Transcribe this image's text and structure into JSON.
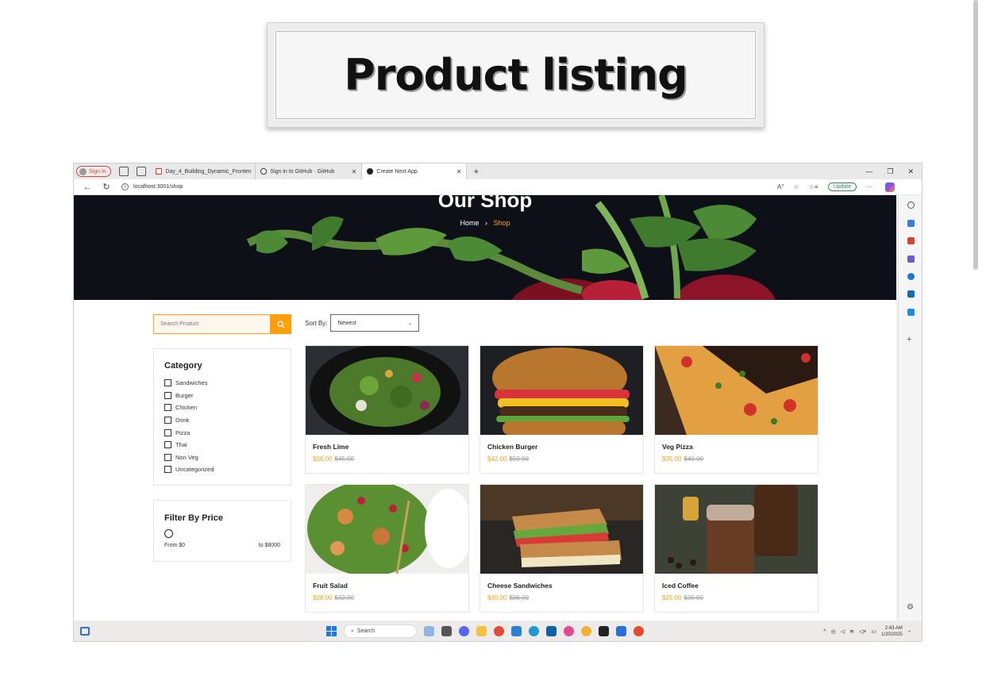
{
  "banner": {
    "title": "Product listing"
  },
  "browser": {
    "signin_label": "Sign in",
    "tabs": [
      {
        "label": "Day_4_Building_Dynamic_Fronten",
        "icon": "pdf-icon",
        "active": false
      },
      {
        "label": "Sign in to GitHub · GitHub",
        "icon": "github-icon",
        "active": false
      },
      {
        "label": "Create Next App",
        "icon": "nextjs-icon",
        "active": true
      }
    ],
    "url": "localhost:3001/shop",
    "update_label": "Update"
  },
  "hero": {
    "title": "Our Shop",
    "breadcrumb_home": "Home",
    "breadcrumb_sep": "›",
    "breadcrumb_current": "Shop"
  },
  "search": {
    "placeholder": "Search Product"
  },
  "sort": {
    "label": "Sort By:",
    "selected": "Newest"
  },
  "category": {
    "title": "Category",
    "items": [
      "Sandwiches",
      "Burger",
      "Chicken",
      "Drink",
      "Pizza",
      "Thai",
      "Non Veg",
      "Uncategorized"
    ]
  },
  "price_filter": {
    "title": "Filter By Price",
    "from": "From $0",
    "to": "to $8000"
  },
  "products": [
    {
      "name": "Fresh Lime",
      "price": "$38.00",
      "old_price": "$45.00"
    },
    {
      "name": "Chicken Burger",
      "price": "$42.00",
      "old_price": "$50.00"
    },
    {
      "name": "Veg Pizza",
      "price": "$35.00",
      "old_price": "$40.00"
    },
    {
      "name": "Fruit Salad",
      "price": "$28.00",
      "old_price": "$32.00"
    },
    {
      "name": "Cheese Sandwiches",
      "price": "$30.00",
      "old_price": "$36.00"
    },
    {
      "name": "Iced Coffee",
      "price": "$25.00",
      "old_price": "$30.00"
    }
  ],
  "taskbar": {
    "search_label": "Search",
    "time": "2:43 AM",
    "date": "1/20/2025"
  },
  "colors": {
    "accent": "#ff9f0d",
    "hero_bg": "#0d1117"
  }
}
